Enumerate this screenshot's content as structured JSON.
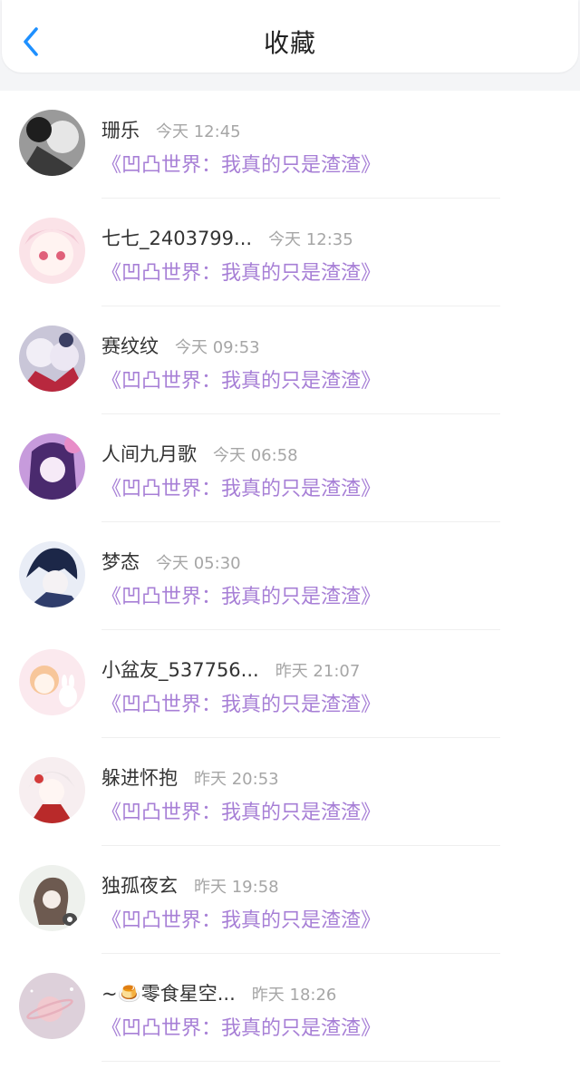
{
  "header": {
    "title": "收藏",
    "back_icon": "chevron-left-icon",
    "accent": "#1e90ff"
  },
  "colors": {
    "link": "#a77fd6",
    "time": "#a6a6a6",
    "name": "#333333"
  },
  "items": [
    {
      "name": "珊乐",
      "time": "今天 12:45",
      "book": "《凹凸世界：我真的只是渣渣》"
    },
    {
      "name": "七七_2403799...",
      "time": "今天 12:35",
      "book": "《凹凸世界：我真的只是渣渣》"
    },
    {
      "name": "赛纹纹",
      "time": "今天 09:53",
      "book": "《凹凸世界：我真的只是渣渣》"
    },
    {
      "name": "人间九月歌",
      "time": "今天 06:58",
      "book": "《凹凸世界：我真的只是渣渣》"
    },
    {
      "name": "梦态",
      "time": "今天 05:30",
      "book": "《凹凸世界：我真的只是渣渣》"
    },
    {
      "name": "小盆友_537756...",
      "time": "昨天 21:07",
      "book": "《凹凸世界：我真的只是渣渣》"
    },
    {
      "name": "躲进怀抱",
      "time": "昨天 20:53",
      "book": "《凹凸世界：我真的只是渣渣》"
    },
    {
      "name": "独孤夜玄",
      "time": "昨天 19:58",
      "book": "《凹凸世界：我真的只是渣渣》"
    },
    {
      "name": "~🍮零食星空...",
      "time": "昨天 18:26",
      "book": "《凹凸世界：我真的只是渣渣》"
    }
  ]
}
